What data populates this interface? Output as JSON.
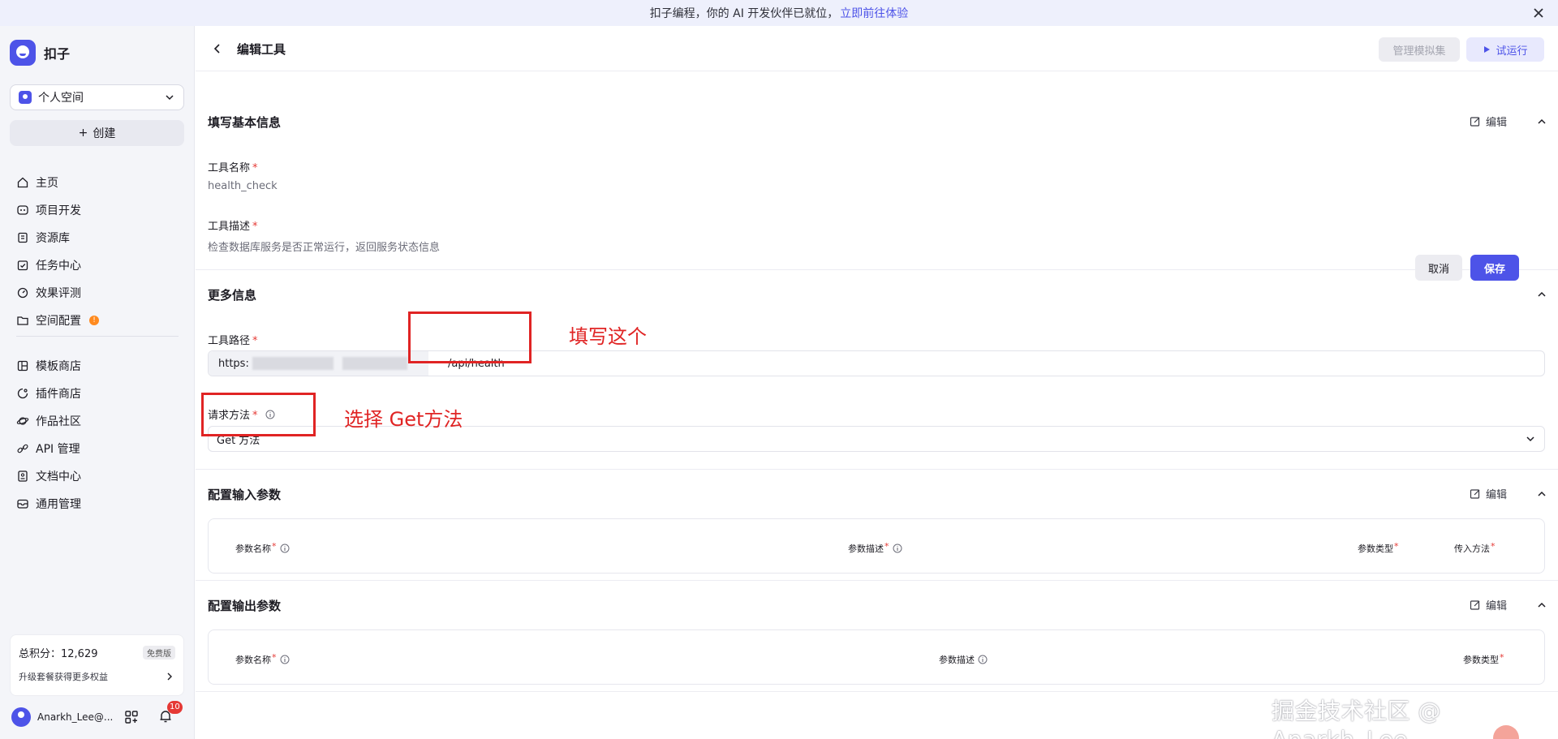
{
  "banner": {
    "text": "扣子编程，你的 AI 开发伙伴已就位，",
    "link": "立即前往体验"
  },
  "sidebar": {
    "brand": "扣子",
    "space": "个人空间",
    "create": "创建",
    "items_main": [
      {
        "label": "主页",
        "icon": "home-icon"
      },
      {
        "label": "项目开发",
        "icon": "project-icon"
      },
      {
        "label": "资源库",
        "icon": "library-icon"
      },
      {
        "label": "任务中心",
        "icon": "task-icon"
      },
      {
        "label": "效果评测",
        "icon": "gauge-icon"
      },
      {
        "label": "空间配置",
        "icon": "folder-config-icon",
        "badge": "!"
      }
    ],
    "items_secondary": [
      {
        "label": "模板商店",
        "icon": "template-icon"
      },
      {
        "label": "插件商店",
        "icon": "plugin-icon"
      },
      {
        "label": "作品社区",
        "icon": "community-icon"
      },
      {
        "label": "API 管理",
        "icon": "link-icon"
      },
      {
        "label": "文档中心",
        "icon": "doc-icon"
      },
      {
        "label": "通用管理",
        "icon": "inbox-icon"
      }
    ],
    "points_label": "总积分：12,629",
    "plan_badge": "免费版",
    "upgrade_text": "升级套餐获得更多权益",
    "username": "Anarkh_Lee@...",
    "notification_count": "10"
  },
  "header": {
    "title": "编辑工具",
    "manage_btn": "管理模拟集",
    "run_btn": "试运行"
  },
  "basic_info": {
    "title": "填写基本信息",
    "edit": "编辑",
    "name_label": "工具名称",
    "name_value": "health_check",
    "desc_label": "工具描述",
    "desc_value": "检查数据库服务是否正常运行，返回服务状态信息"
  },
  "more_info": {
    "title": "更多信息",
    "cancel": "取消",
    "save": "保存",
    "path_label": "工具路径",
    "url_prefix": "https:",
    "url_path": "/api/health",
    "method_label": "请求方法",
    "method_value": "Get 方法"
  },
  "input_params": {
    "title": "配置输入参数",
    "edit": "编辑",
    "columns": [
      "参数名称",
      "参数描述",
      "参数类型",
      "传入方法"
    ]
  },
  "output_params": {
    "title": "配置输出参数",
    "edit": "编辑",
    "columns": [
      "参数名称",
      "参数描述",
      "参数类型"
    ]
  },
  "annotations": {
    "fill_this": "填写这个",
    "choose_get": "选择 Get方法"
  },
  "watermark": "掘金技术社区 @ Anarkh_Lee",
  "colors": {
    "accent": "#4d53e8",
    "annotation": "#e02424",
    "required": "#e53935"
  }
}
